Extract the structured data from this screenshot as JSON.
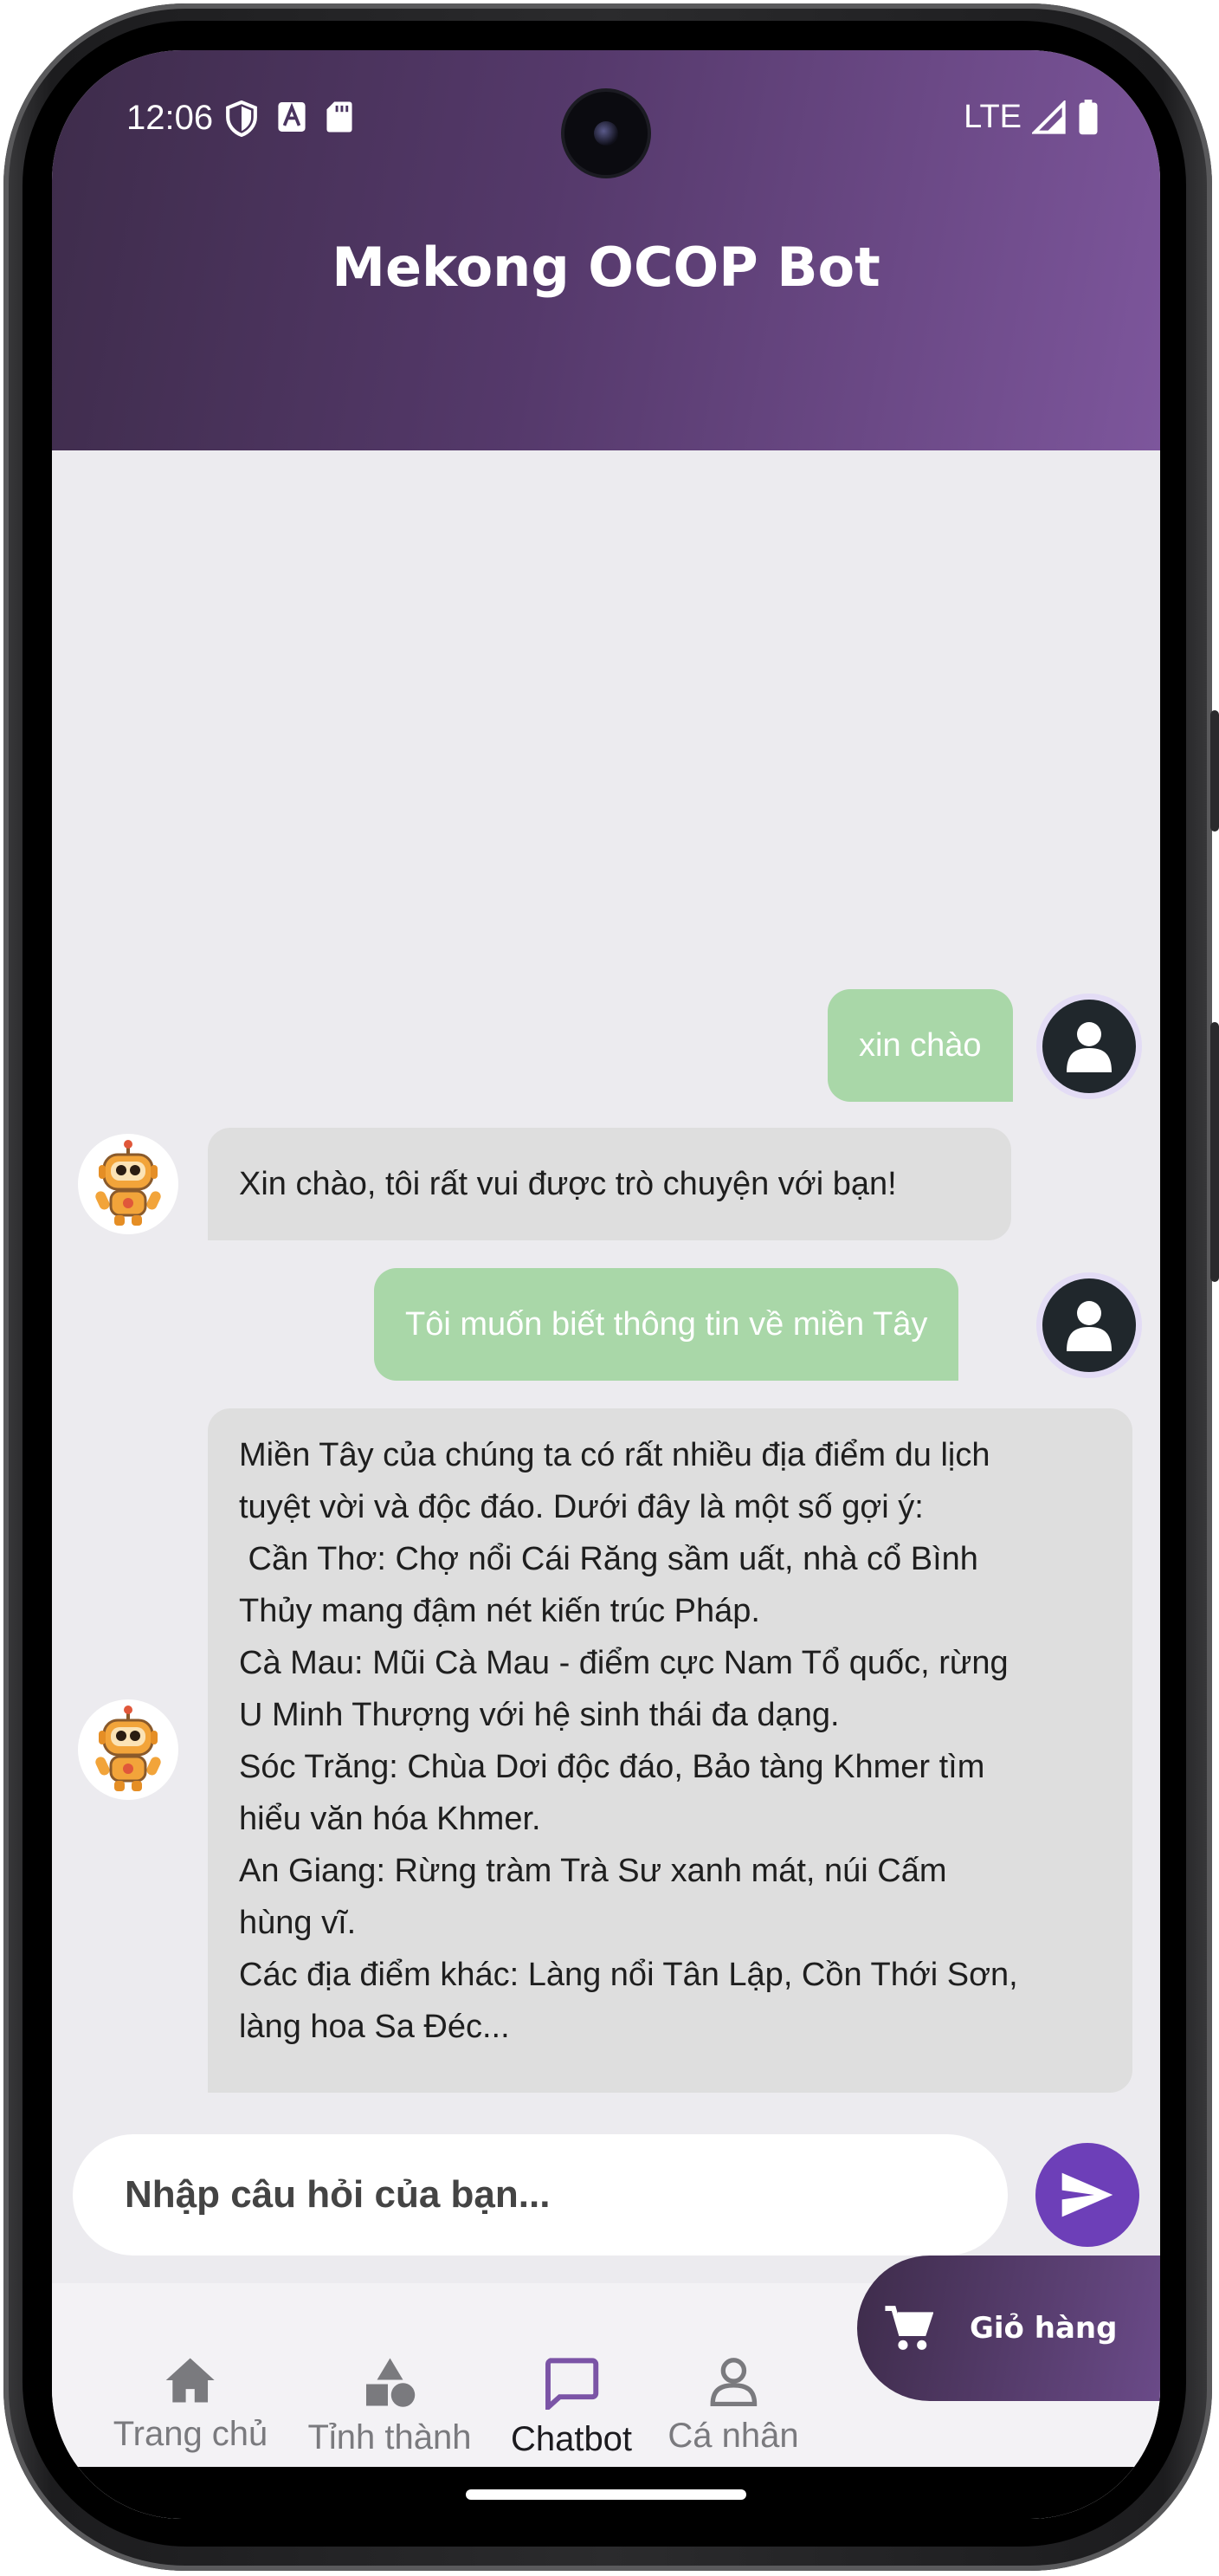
{
  "status_bar": {
    "time": "12:06",
    "network": "LTE"
  },
  "header": {
    "title": "Mekong OCOP Bot"
  },
  "messages": {
    "m1": "xin chào",
    "m2": "Xin chào, tôi rất vui được trò chuyện với bạn!",
    "m3": "Tôi muốn biết thông tin về miền Tây",
    "m4_lines": {
      "l1": "Miền Tây của chúng ta có rất nhiều địa điểm du lịch",
      "l2": "tuyệt vời và độc đáo. Dưới đây là một số gợi ý:",
      "l3": " Cần Thơ: Chợ nổi Cái Răng sầm uất, nhà cổ Bình",
      "l4": "Thủy mang đậm nét kiến trúc Pháp.",
      "l5": "Cà Mau: Mũi Cà Mau - điểm cực Nam Tổ quốc, rừng",
      "l6": "U Minh Thượng với hệ sinh thái đa dạng.",
      "l7": "Sóc Trăng: Chùa Dơi độc đáo, Bảo tàng Khmer tìm",
      "l8": "hiểu văn hóa Khmer.",
      "l9": "An Giang: Rừng tràm Trà Sư xanh mát, núi Cấm",
      "l10": "hùng vĩ.",
      "l11": "Các địa điểm khác: Làng nổi Tân Lập, Cồn Thới Sơn,",
      "l12": "làng hoa Sa Đéc..."
    }
  },
  "input": {
    "placeholder": "Nhập câu hỏi của bạn..."
  },
  "nav": {
    "home": "Trang chủ",
    "provinces": "Tỉnh thành",
    "chatbot": "Chatbot",
    "profile": "Cá nhân"
  },
  "cart": {
    "label": "Giỏ hàng"
  },
  "colors": {
    "header_start": "#3e2c4b",
    "header_end": "#7d569c",
    "user_bubble": "#a9d7a8",
    "bot_bubble": "#dedede",
    "send_button": "#6d3fb8",
    "nav_active": "#7b54a6"
  },
  "icons": {
    "status": [
      "shield-icon",
      "font-a-icon",
      "sd-card-icon",
      "signal-icon",
      "battery-icon"
    ],
    "nav": [
      "home-icon",
      "shapes-icon",
      "chat-icon",
      "person-icon"
    ],
    "cart": "shopping-cart-icon",
    "send": "send-icon",
    "avatars": [
      "user-avatar-icon",
      "robot-avatar-icon"
    ]
  }
}
